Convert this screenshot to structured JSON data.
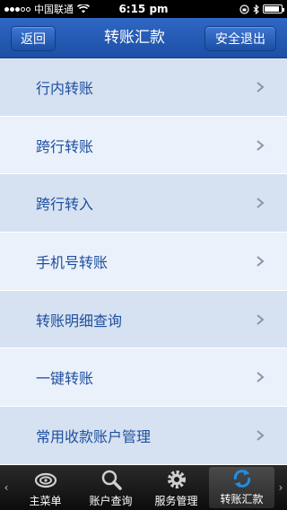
{
  "status_bar": {
    "carrier": "中国联通",
    "time": "6:15 pm"
  },
  "nav": {
    "back_label": "返回",
    "title": "转账汇款",
    "logout_label": "安全退出"
  },
  "menu": {
    "items": [
      {
        "label": "行内转账"
      },
      {
        "label": "跨行转账"
      },
      {
        "label": "跨行转入"
      },
      {
        "label": "手机号转账"
      },
      {
        "label": "转账明细查询"
      },
      {
        "label": "一键转账"
      },
      {
        "label": "常用收款账户管理"
      }
    ]
  },
  "tabbar": {
    "tabs": [
      {
        "label": "主菜单",
        "icon": "swirl-logo-icon"
      },
      {
        "label": "账户查询",
        "icon": "magnifier-icon"
      },
      {
        "label": "服务管理",
        "icon": "gear-icon"
      },
      {
        "label": "转账汇款",
        "icon": "refresh-arrows-icon"
      }
    ],
    "active_index": 3
  },
  "colors": {
    "nav_bg": "#2a5fbb",
    "item_text": "#1f4fa0",
    "row_odd": "#d6e2f1",
    "row_even": "#eaf1fa",
    "active_tab_icon": "#1e8fe6"
  }
}
